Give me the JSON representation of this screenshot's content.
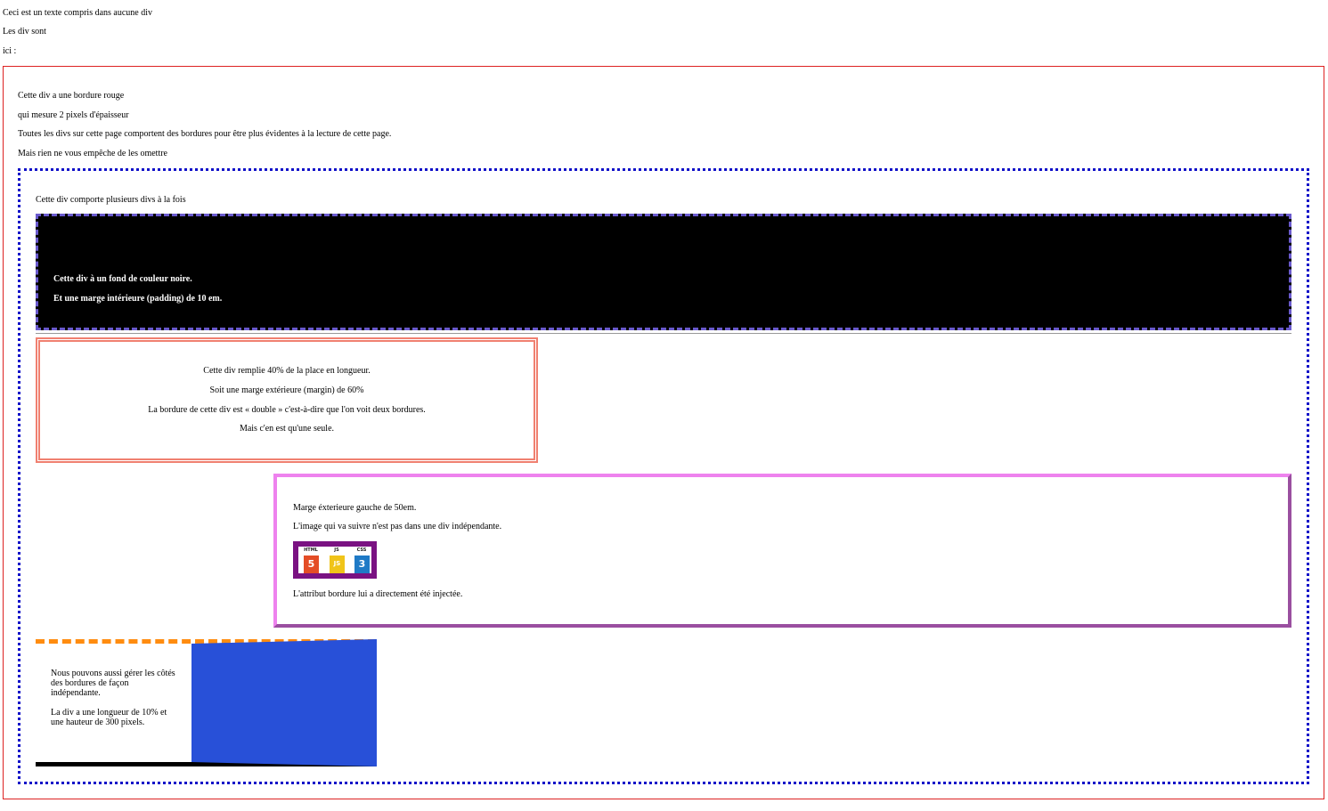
{
  "intro": [
    "Ceci est un texte compris dans aucune div",
    "Les div sont",
    "ici :"
  ],
  "red_div": {
    "lines": [
      "Cette div a une bordure rouge",
      "qui mesure 2 pixels d'épaisseur",
      "Toutes les divs sur cette page comportent des bordures pour être plus évidentes à la lecture de cette page.",
      "Mais rien ne vous empêche de les omettre"
    ],
    "border_color": "#dd2222"
  },
  "blue_div": {
    "text": "Cette div comporte plusieurs divs à la fois",
    "border_color": "#1010c8"
  },
  "black_div": {
    "lines": [
      "Cette div à un fond de couleur noire.",
      "Et une marge intérieure (padding) de 10 em."
    ],
    "background": "#000000",
    "border_color": "#6a5acd"
  },
  "double_div": {
    "lines": [
      "Cette div remplie 40% de la place en longueur.",
      "Soit une marge extérieure (margin) de 60%",
      "La bordure de cette div est « double » c'est-à-dire que l'on voit deux bordures.",
      "Mais c'en est qu'une seule."
    ],
    "border_color": "#f08070"
  },
  "violet_div": {
    "line1": "Marge éxterieure gauche de 50em.",
    "line2": "L'image qui va suivre n'est pas dans une div indépendante.",
    "line3": "L'attribut bordure lui a directement été injectée.",
    "logo": {
      "icon": "html-js-css-logo",
      "border_color": "#7a1282",
      "badges": [
        {
          "label": "HTML",
          "glyph": "5",
          "color": "#e44d26"
        },
        {
          "label": "JS",
          "glyph": "JS",
          "color": "#f0c419"
        },
        {
          "label": "CSS",
          "glyph": "3",
          "color": "#1f7ac6"
        }
      ]
    }
  },
  "sides_div": {
    "para1": "Nous pouvons aussi gérer les côtés des bordures de façon indépendante.",
    "para2": "La div a une longueur de 10% et une hauteur de 300 pixels.",
    "colors": {
      "top": "#ff8c10",
      "right": "#2850d8",
      "bottom": "#000000"
    }
  }
}
